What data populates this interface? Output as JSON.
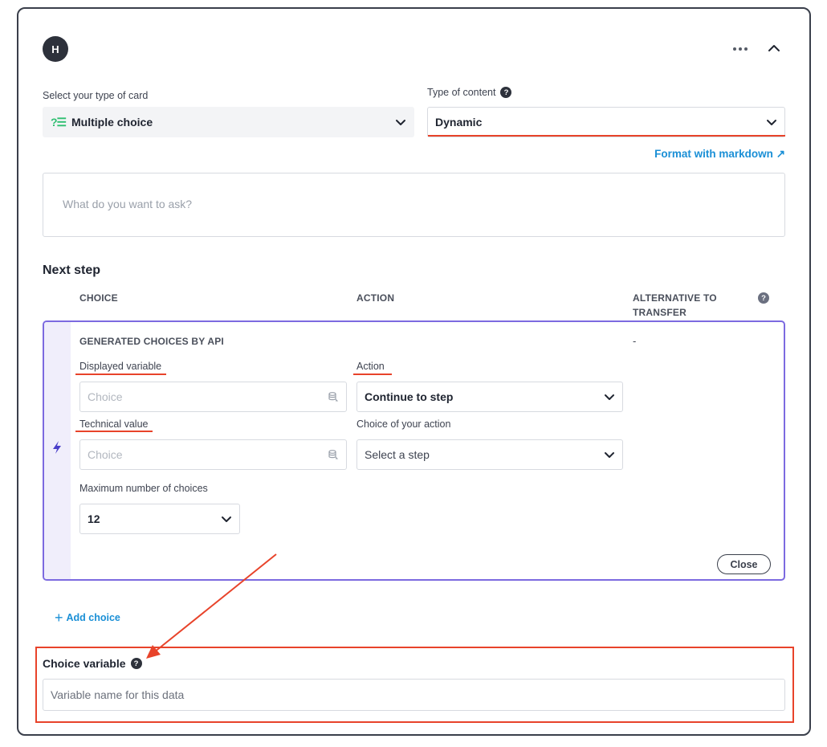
{
  "header": {
    "avatar_letter": "H",
    "more_icon": "more-horizontal-icon",
    "collapse_icon": "chevron-up-icon"
  },
  "card_type": {
    "label": "Select your type of card",
    "icon_text": "?☰",
    "value": "Multiple choice"
  },
  "content_type": {
    "label": "Type of content",
    "help": "?",
    "value": "Dynamic"
  },
  "format_markdown": {
    "label": "Format with markdown",
    "icon": "↗"
  },
  "question": {
    "placeholder": "What do you want to ask?"
  },
  "next_step": {
    "title": "Next step",
    "columns": {
      "choice": "CHOICE",
      "action": "ACTION",
      "alt_line1": "ALTERNATIVE TO",
      "alt_line2": "TRANSFER",
      "help": "?"
    }
  },
  "generated": {
    "heading": "GENERATED CHOICES BY API",
    "alternative_value": "-",
    "displayed_variable": {
      "label": "Displayed variable",
      "placeholder": "Choice"
    },
    "technical_value": {
      "label": "Technical value",
      "placeholder": "Choice"
    },
    "action": {
      "label": "Action",
      "value": "Continue to step"
    },
    "action_choice": {
      "label": "Choice of your action",
      "value": "Select a step"
    },
    "max_choices": {
      "label": "Maximum number of choices",
      "value": "12"
    },
    "close_label": "Close"
  },
  "add_choice": {
    "plus": "+",
    "label": "Add choice"
  },
  "choice_variable": {
    "label": "Choice variable",
    "help": "?",
    "placeholder": "Variable name for this data"
  },
  "colors": {
    "accent_blue": "#1a8fd6",
    "purple_border": "#7c6ae0",
    "annotation_red": "#e8432a",
    "green_icon": "#2fbf71"
  }
}
